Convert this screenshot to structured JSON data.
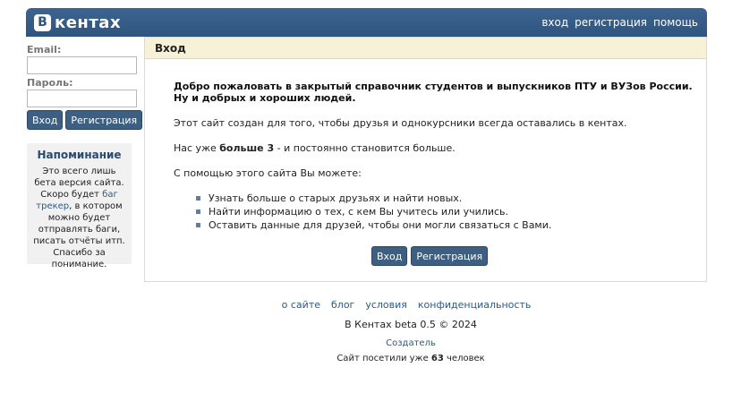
{
  "header": {
    "logo_letter": "В",
    "logo_text": "кентах",
    "nav": [
      {
        "label": "вход"
      },
      {
        "label": "регистрация"
      },
      {
        "label": "помощь"
      }
    ]
  },
  "sidebar": {
    "email_label": "Email:",
    "email_value": "",
    "password_label": "Пароль:",
    "password_value": "",
    "login_button": "Вход",
    "register_button": "Регистрация",
    "reminder": {
      "title": "Напоминание",
      "text_before": "Это всего лишь бета версия сайта. Скоро будет ",
      "link": "баг трекер",
      "text_after": ", в котором можно будет отправлять баги, писать отчёты итп. Спасибо за понимание."
    }
  },
  "main": {
    "title": "Вход",
    "welcome_line1": "Добро пожаловать в закрытый справочник студентов и выпускников ПТУ и ВУЗов России.",
    "welcome_line2": "Ну и добрых и хороших людей.",
    "intro": "Этот сайт создан для того, чтобы друзья и однокурсники всегда оставались в кентах.",
    "count_prefix": "Нас уже ",
    "count_bold": "больше 3",
    "count_suffix": " - и постоянно становится больше.",
    "features_intro": "С помощью этого сайта Вы можете:",
    "features": [
      "Узнать больше о старых друзьях и найти новых.",
      "Найти информацию о тех, с кем Вы учитесь или учились.",
      "Оставить данные для друзей, чтобы они могли связаться с Вами."
    ],
    "login_button": "Вход",
    "register_button": "Регистрация"
  },
  "footer": {
    "links": [
      {
        "label": "о сайте"
      },
      {
        "label": "блог"
      },
      {
        "label": "условия"
      },
      {
        "label": "конфиденциальность"
      }
    ],
    "copyright": "В Кентах beta 0.5 © 2024",
    "creator": "Создатель",
    "visits_prefix": "Сайт посетили уже ",
    "visits_count": "63",
    "visits_suffix": " человек"
  }
}
